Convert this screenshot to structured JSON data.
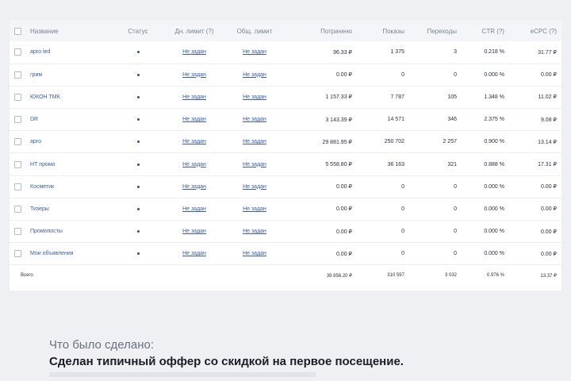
{
  "table": {
    "columns": [
      "Название",
      "Статус",
      "Дн. лимит (?)",
      "Общ. лимит",
      "Потрачено",
      "Показы",
      "Переходы",
      "CTR (?)",
      "eCPC (?)"
    ],
    "rows": [
      {
        "name": "apro led",
        "day_limit": "Не задан",
        "total_limit": "Не задан",
        "spent": "96.33 ₽",
        "impressions": "1 375",
        "clicks": "3",
        "ctr": "0.218 %",
        "ecpc": "31.77 ₽"
      },
      {
        "name": "грим",
        "day_limit": "Не задан",
        "total_limit": "Не задан",
        "spent": "0.00 ₽",
        "impressions": "0",
        "clicks": "0",
        "ctr": "0.000 %",
        "ecpc": "0.00 ₽"
      },
      {
        "name": "ЮКОН ТМК",
        "day_limit": "Не задан",
        "total_limit": "Не задан",
        "spent": "1 157.33 ₽",
        "impressions": "7 787",
        "clicks": "105",
        "ctr": "1.348 %",
        "ecpc": "11.02 ₽"
      },
      {
        "name": "DR",
        "day_limit": "Не задан",
        "total_limit": "Не задан",
        "spent": "3 143.39 ₽",
        "impressions": "14 571",
        "clicks": "346",
        "ctr": "2.375 %",
        "ecpc": "9.08 ₽"
      },
      {
        "name": "apro",
        "day_limit": "Не задан",
        "total_limit": "Не задан",
        "spent": "29 881.95 ₽",
        "impressions": "250 702",
        "clicks": "2 257",
        "ctr": "0.900 %",
        "ecpc": "13.14 ₽"
      },
      {
        "name": "НТ промо",
        "day_limit": "Не задан",
        "total_limit": "Не задан",
        "spent": "5 558.80 ₽",
        "impressions": "36 163",
        "clicks": "321",
        "ctr": "0.888 %",
        "ecpc": "17.31 ₽"
      },
      {
        "name": "Косметик",
        "day_limit": "Не задан",
        "total_limit": "Не задан",
        "spent": "0.00 ₽",
        "impressions": "0",
        "clicks": "0",
        "ctr": "0.000 %",
        "ecpc": "0.00 ₽"
      },
      {
        "name": "Тизеры",
        "day_limit": "Не задан",
        "total_limit": "Не задан",
        "spent": "0.00 ₽",
        "impressions": "0",
        "clicks": "0",
        "ctr": "0.000 %",
        "ecpc": "0.00 ₽"
      },
      {
        "name": "Промопосты",
        "day_limit": "Не задан",
        "total_limit": "Не задан",
        "spent": "0.00 ₽",
        "impressions": "0",
        "clicks": "0",
        "ctr": "0.000 %",
        "ecpc": "0.00 ₽"
      },
      {
        "name": "Мои объявления",
        "day_limit": "Не задан",
        "total_limit": "Не задан",
        "spent": "0.00 ₽",
        "impressions": "0",
        "clicks": "0",
        "ctr": "0.000 %",
        "ecpc": "0.00 ₽"
      }
    ],
    "total": {
      "label": "Всего",
      "spent": "39 856.20 ₽",
      "impressions": "310 597",
      "clicks": "3 032",
      "ctr": "0.976 %",
      "ecpc": "13.37 ₽"
    }
  },
  "section": {
    "title": "Что было сделано:",
    "text": "Сделан типичный оффер со скидкой на первое посещение."
  },
  "colors": {
    "link": "#3a5bb0",
    "header_bg": "#f3f5f8",
    "page_bg": "#eef0f4"
  },
  "icons": {
    "status": "status-dot-icon",
    "checkbox": "checkbox"
  }
}
